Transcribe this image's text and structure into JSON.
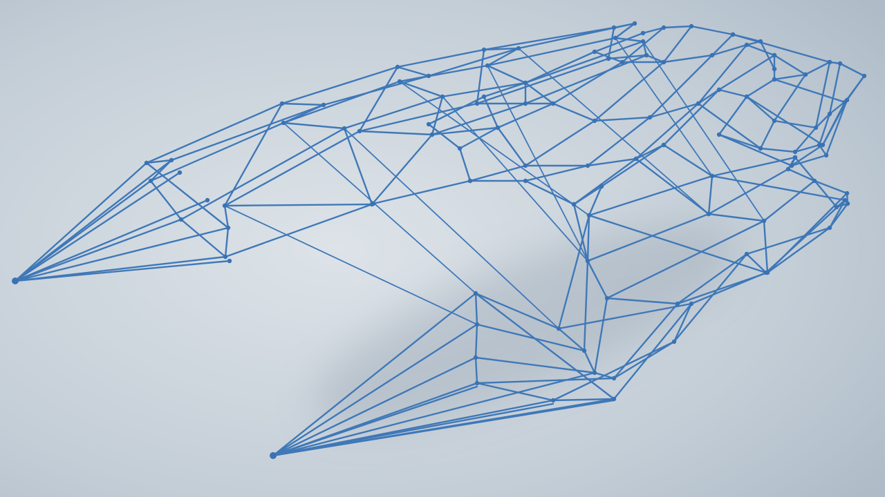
{
  "scene": {
    "subject": "wireframe-catamaran-hull",
    "colors": {
      "wire": "#3f78b8",
      "wire_dark": "#2f62a0",
      "node": "#3a72b4",
      "bg_light": "#dde3e8",
      "bg_mid": "#c4ced7",
      "bg_dark": "#a9b7c4",
      "shadow": "#8e9cab"
    }
  }
}
